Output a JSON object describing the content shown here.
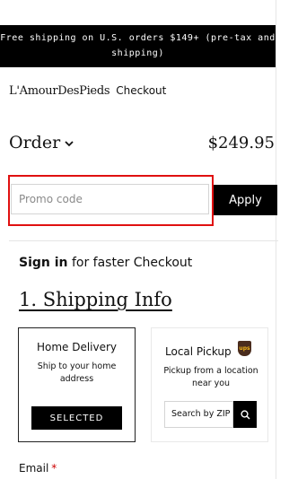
{
  "banner": {
    "line1": "Free shipping on U.S. orders $149+ (pre-tax and",
    "line2": "shipping)"
  },
  "header": {
    "brand": "L'AmourDesPieds",
    "title": "Checkout"
  },
  "order": {
    "label": "Order",
    "total": "$249.95"
  },
  "promo": {
    "placeholder": "Promo code",
    "apply_label": "Apply"
  },
  "signin": {
    "link": "Sign in",
    "rest": " for faster Checkout"
  },
  "shipping": {
    "title": "1. Shipping Info ",
    "home": {
      "title": "Home Delivery",
      "desc": "Ship to your home address",
      "button": "SELECTED"
    },
    "local": {
      "title": "Local Pickup",
      "icon": "ups-icon",
      "badge": "ups",
      "desc": "Pickup from a location near you",
      "search_placeholder": "Search by ZIP"
    }
  },
  "email": {
    "label": "Email",
    "required_mark": "*"
  },
  "colors": {
    "accent": "#000000",
    "highlight": "#e01010",
    "ups_brown": "#4a2c1d",
    "ups_gold": "#f2b417"
  }
}
